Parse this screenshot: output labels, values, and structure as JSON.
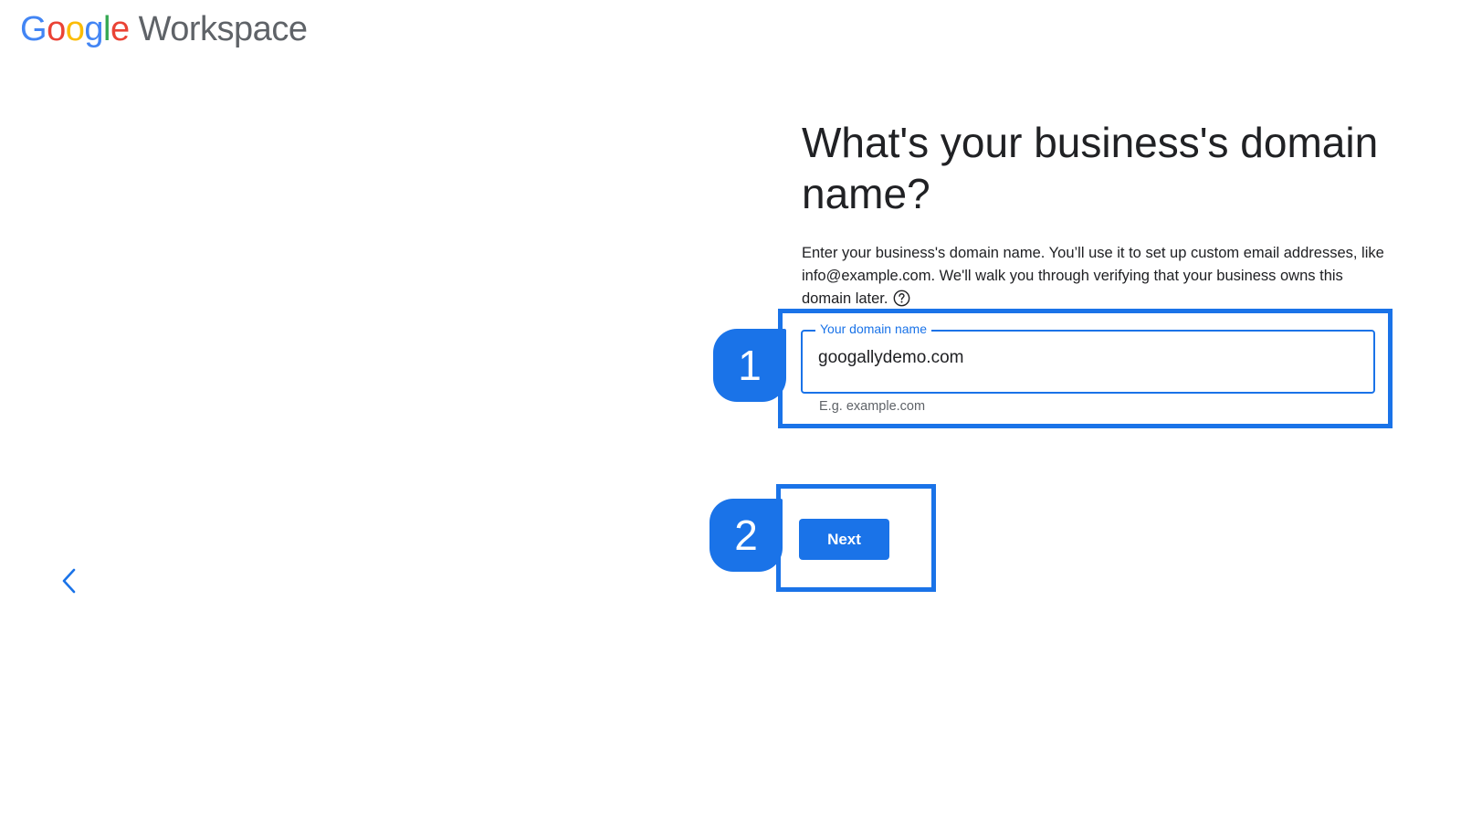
{
  "logo": {
    "letters": [
      {
        "char": "G",
        "color": "#4285F4"
      },
      {
        "char": "o",
        "color": "#EA4335"
      },
      {
        "char": "o",
        "color": "#FBBC05"
      },
      {
        "char": "g",
        "color": "#4285F4"
      },
      {
        "char": "l",
        "color": "#34A853"
      },
      {
        "char": "e",
        "color": "#EA4335"
      }
    ],
    "product": "Workspace"
  },
  "heading": "What's your business's domain name?",
  "description": "Enter your business's domain name. You’ll use it to set up custom email addresses, like info@example.com. We'll walk you through verifying that your business owns this domain later.",
  "help_icon": "help-circle-icon",
  "domain_field": {
    "label": "Your domain name",
    "value": "googallydemo.com",
    "hint": "E.g. example.com"
  },
  "steps": {
    "step_1": "1",
    "step_2": "2"
  },
  "next_button": "Next",
  "back_icon": "chevron-left-icon",
  "colors": {
    "accent": "#1a73e8",
    "text": "#202124",
    "muted": "#5f6368"
  }
}
